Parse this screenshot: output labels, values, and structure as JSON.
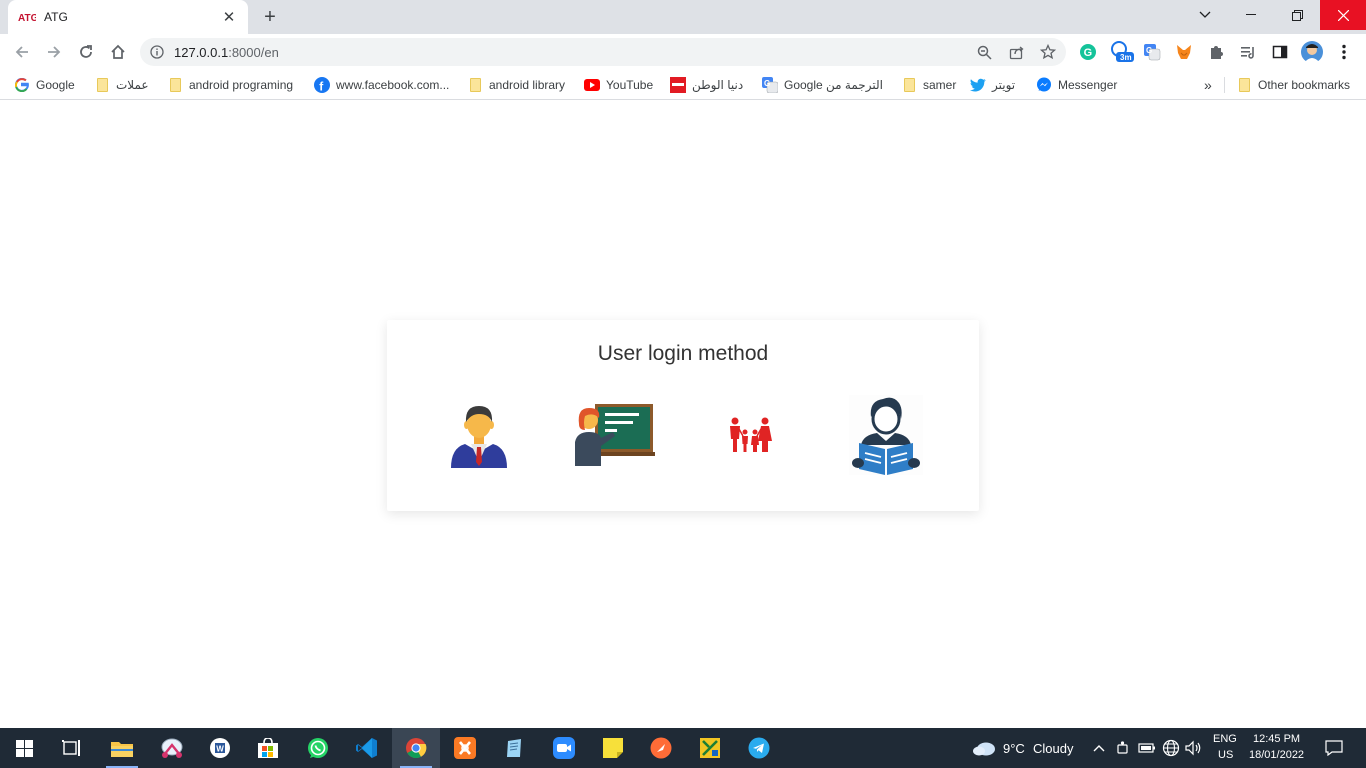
{
  "browser": {
    "tab": {
      "title": "ATG",
      "favicon": "atg-logo"
    },
    "address": {
      "host": "127.0.0.1",
      "path": ":8000/en"
    },
    "extensions": [
      {
        "name": "grammarly-icon",
        "color": "#15c39a"
      },
      {
        "name": "badge-extension-icon",
        "badge": "3m",
        "color": "#1a73e8"
      },
      {
        "name": "google-translate-icon",
        "color": "#4285f4"
      },
      {
        "name": "metamask-icon",
        "color": "#f6851b"
      },
      {
        "name": "extensions-puzzle-icon"
      },
      {
        "name": "media-control-icon"
      },
      {
        "name": "side-panel-icon"
      },
      {
        "name": "profile-avatar"
      },
      {
        "name": "more-menu-icon"
      }
    ]
  },
  "bookmarks": {
    "items": [
      {
        "label": "Google",
        "icon": "google-icon"
      },
      {
        "label": "عملات",
        "icon": "folder-icon"
      },
      {
        "label": "android programing",
        "icon": "folder-icon"
      },
      {
        "label": "www.facebook.com...",
        "icon": "facebook-icon"
      },
      {
        "label": "android library",
        "icon": "folder-icon"
      },
      {
        "label": "YouTube",
        "icon": "youtube-icon"
      },
      {
        "label": "دنيا الوطن",
        "icon": "dunia-alwatan-icon"
      },
      {
        "label": "Google الترجمة من",
        "icon": "google-translate-icon"
      },
      {
        "label": "samer",
        "icon": "folder-icon"
      },
      {
        "label": "تويتر",
        "icon": "twitter-icon"
      },
      {
        "label": "Messenger",
        "icon": "messenger-icon"
      }
    ],
    "overflow": "»",
    "other": "Other bookmarks"
  },
  "page": {
    "title": "User login method",
    "options": [
      {
        "name": "admin-login-option",
        "icon": "businessman-icon"
      },
      {
        "name": "teacher-login-option",
        "icon": "teacher-blackboard-icon"
      },
      {
        "name": "parent-login-option",
        "icon": "family-icon"
      },
      {
        "name": "student-login-option",
        "icon": "student-reading-icon"
      }
    ]
  },
  "taskbar": {
    "weather": {
      "temp": "9°C",
      "condition": "Cloudy"
    },
    "language": {
      "lang": "ENG",
      "region": "US"
    },
    "clock": {
      "time": "12:45 PM",
      "date": "18/01/2022"
    }
  }
}
